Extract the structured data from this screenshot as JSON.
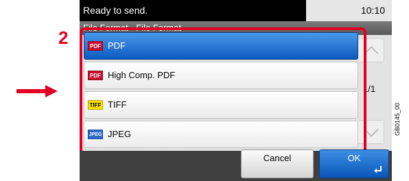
{
  "status": {
    "message": "Ready to send.",
    "time": "10:10"
  },
  "title": "File Format - File Format",
  "list": {
    "items": [
      {
        "label": "PDF",
        "icon": "pdf-icon",
        "icon_text": "PDF",
        "selected": true
      },
      {
        "label": "High Comp. PDF",
        "icon": "high-comp-pdf-icon",
        "icon_text": "PDF",
        "selected": false
      },
      {
        "label": "TIFF",
        "icon": "tiff-icon",
        "icon_text": "TIFF",
        "selected": false
      },
      {
        "label": "JPEG",
        "icon": "jpeg-icon",
        "icon_text": "JPEG",
        "selected": false
      }
    ],
    "page": "1/1"
  },
  "buttons": {
    "cancel": "Cancel",
    "ok": "OK"
  },
  "annotation": {
    "step": "2",
    "figure_code": "GB0145_00"
  },
  "colors": {
    "highlight": "#e00024",
    "selected": "#0c5bc0",
    "pointer": "#e00024"
  }
}
